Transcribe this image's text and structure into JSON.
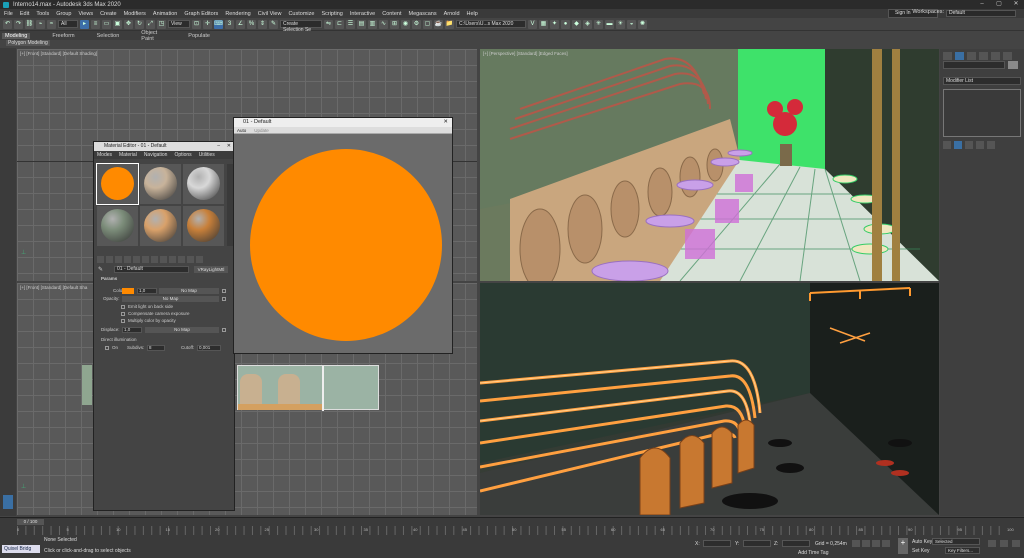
{
  "window": {
    "title": "Interno14.max - Autodesk 3ds Max 2020"
  },
  "menu": [
    "File",
    "Edit",
    "Tools",
    "Group",
    "Views",
    "Create",
    "Modifiers",
    "Animation",
    "Graph Editors",
    "Rendering",
    "Civil View",
    "Customize",
    "Scripting",
    "Interactive",
    "Content",
    "Megascans",
    "Arnold",
    "Help"
  ],
  "account": {
    "signin": "Sign In",
    "workspaces_label": "Workspaces:",
    "workspace_value": "Default"
  },
  "toolbar": {
    "filter": "All",
    "view": "View",
    "selection_set": "Create Selection Se",
    "path": "C:\\Users\\U...s Max 2020"
  },
  "ribbon": {
    "tabs": [
      "Modeling",
      "Freeform",
      "Selection",
      "Object Paint",
      "Populate"
    ],
    "active_tab": "Modeling",
    "panel": "Polygon Modeling"
  },
  "viewports": {
    "front": "[+] [Front] [Standard] [Default Shading]",
    "left": "[+] [Front] [Standard] [Default Sha",
    "perspective": "[+] [Perspective] [Standard] [Edged Faces]",
    "camera": ""
  },
  "command_panel": {
    "modifier_list": "Modifier List"
  },
  "material_editor": {
    "title": "Material Editor - 01 - Default",
    "menu": [
      "Modes",
      "Material",
      "Navigation",
      "Options",
      "Utilities"
    ],
    "slot_colors": [
      "#ff8a00",
      "#c8b39a",
      "#d8d8d8",
      "#7c8d7a",
      "#d9a16a",
      "#c8803a"
    ],
    "material_name": "01 - Default",
    "material_type": "VRayLightMtl",
    "params_title": "Params",
    "color_label": "Color:",
    "color_swatch": "#ff8a00",
    "color_value": "1,0",
    "no_map": "No Map",
    "opacity_label": "Opacity:",
    "emit_back": "Emit light on back side",
    "compensate": "Compensate camera exposure",
    "multiply": "Multiply color by opacity",
    "displace_label": "Displace:",
    "displace_value": "1,0",
    "direct_illum": "Direct illumination",
    "on": "On",
    "subdivs_label": "Subdivs:",
    "subdivs_value": "8",
    "cutoff_label": "Cutoff:",
    "cutoff_value": "0,001"
  },
  "preview": {
    "title": "01 - Default",
    "auto": "Auto",
    "update": "Update",
    "color": "#ff8a00"
  },
  "timeline": {
    "slider": "0 / 100",
    "tick_labels": [
      "0",
      "5",
      "10",
      "15",
      "20",
      "25",
      "30",
      "35",
      "40",
      "45",
      "50",
      "55",
      "60",
      "65",
      "70",
      "75",
      "80",
      "85",
      "90",
      "95",
      "100"
    ]
  },
  "status": {
    "maxscript": "Quixel Bridg",
    "selection": "None Selected",
    "prompt": "Click or click-and-drag to select objects",
    "x_label": "X:",
    "y_label": "Y:",
    "z_label": "Z:",
    "grid": "Grid = 0,254m",
    "add_time_tag": "Add Time Tag",
    "auto_key": "Auto Key",
    "set_key": "Set Key",
    "selected": "Selected",
    "key_filters": "Key Filters..."
  }
}
